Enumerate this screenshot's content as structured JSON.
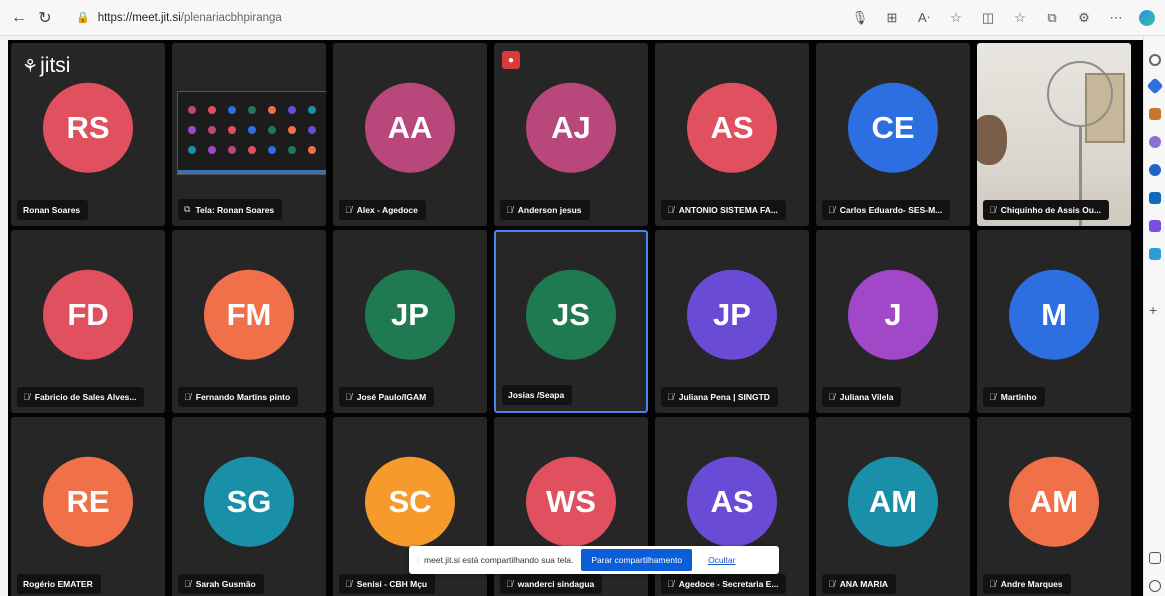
{
  "browser": {
    "url_host": "https://meet.jit.si",
    "url_path": "/plenariacbhpiranga",
    "icons": [
      "back-icon",
      "refresh-icon",
      "lock-icon",
      "microphone-icon",
      "grid-icon",
      "read-aloud-icon",
      "favorite-icon",
      "split-screen-icon",
      "favorites-bar-icon",
      "collections-icon",
      "extensions-icon",
      "more-icon",
      "edge-copilot-icon"
    ]
  },
  "app": {
    "logo_text": "jitsi"
  },
  "tiles": [
    {
      "initials": "RS",
      "name": "Ronan Soares",
      "color": "#e0505e",
      "muted": false,
      "kind": "avatar"
    },
    {
      "initials": "",
      "name": "Tela: Ronan Soares",
      "color": "#262626",
      "muted": false,
      "kind": "screen"
    },
    {
      "initials": "AA",
      "name": "Alex - Agedoce",
      "color": "#b8477b",
      "muted": true,
      "kind": "avatar"
    },
    {
      "initials": "AJ",
      "name": "Anderson jesus",
      "color": "#b8477b",
      "muted": true,
      "kind": "avatar"
    },
    {
      "initials": "AS",
      "name": "ANTONIO SISTEMA FA...",
      "color": "#e0505e",
      "muted": true,
      "kind": "avatar"
    },
    {
      "initials": "CE",
      "name": "Carlos Eduardo- SES-M...",
      "color": "#2d6ee0",
      "muted": true,
      "kind": "avatar"
    },
    {
      "initials": "",
      "name": "Chiquinho de Assis Ou...",
      "color": "#dcd8d0",
      "muted": true,
      "kind": "camera"
    },
    {
      "initials": "FD",
      "name": "Fabricio de Sales Alves...",
      "color": "#e0505e",
      "muted": true,
      "kind": "avatar"
    },
    {
      "initials": "FM",
      "name": "Fernando Martins pinto",
      "color": "#f0704a",
      "muted": true,
      "kind": "avatar"
    },
    {
      "initials": "JP",
      "name": "José Paulo/IGAM",
      "color": "#1f7a52",
      "muted": true,
      "kind": "avatar"
    },
    {
      "initials": "JS",
      "name": "Josias /Seapa",
      "color": "#1f7a52",
      "muted": false,
      "kind": "avatar",
      "active": true
    },
    {
      "initials": "JP",
      "name": "Juliana Pena | SINGTD",
      "color": "#6a4bd6",
      "muted": true,
      "kind": "avatar"
    },
    {
      "initials": "J",
      "name": "Juliana Vilela",
      "color": "#a148c9",
      "muted": true,
      "kind": "avatar"
    },
    {
      "initials": "M",
      "name": "Martinho",
      "color": "#2d6ee0",
      "muted": true,
      "kind": "avatar"
    },
    {
      "initials": "RE",
      "name": "Rogério EMATER",
      "color": "#f0704a",
      "muted": false,
      "kind": "avatar"
    },
    {
      "initials": "SG",
      "name": "Sarah Gusmão",
      "color": "#1a8fa8",
      "muted": true,
      "kind": "avatar"
    },
    {
      "initials": "SC",
      "name": "Senisi - CBH Mçu",
      "color": "#f59a2b",
      "muted": true,
      "kind": "avatar"
    },
    {
      "initials": "WS",
      "name": "wanderci sindagua",
      "color": "#e0505e",
      "muted": true,
      "kind": "avatar"
    },
    {
      "initials": "AS",
      "name": "Agedoce - Secretaria E...",
      "color": "#6a4bd6",
      "muted": true,
      "kind": "avatar"
    },
    {
      "initials": "AM",
      "name": "ANA MARIA",
      "color": "#1a8fa8",
      "muted": true,
      "kind": "avatar"
    },
    {
      "initials": "AM",
      "name": "Andre Marques",
      "color": "#f0704a",
      "muted": true,
      "kind": "avatar"
    }
  ],
  "share_notification": {
    "message": "meet.jit.si está compartilhando sua tela.",
    "stop_label": "Parar compartilhamento",
    "hide_label": "Ocultar"
  }
}
